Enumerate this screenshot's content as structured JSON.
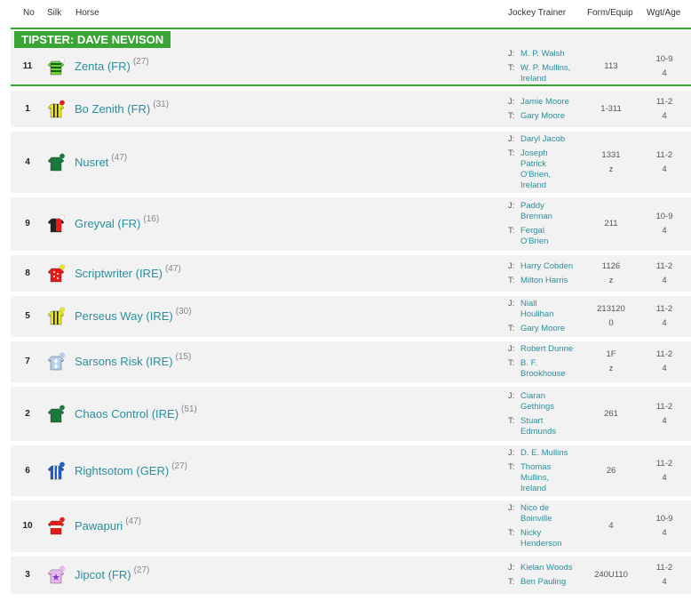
{
  "header": {
    "no": "No",
    "silk": "Silk",
    "horse": "Horse",
    "jockey_trainer": "Jockey Trainer",
    "form": "Form/Equip",
    "wgt": "Wgt/Age"
  },
  "tipster": {
    "label": "TIPSTER: DAVE NEVISON"
  },
  "prefix": {
    "j": "J:",
    "t": "T:"
  },
  "runners": [
    {
      "no": "11",
      "name": "Zenta (FR)",
      "days": "(27)",
      "jockey": [
        "M. P. Walsh"
      ],
      "trainer": [
        "W. P. Mullins,",
        "Ireland"
      ],
      "form": [
        "113"
      ],
      "wgt": "10-9",
      "age": "4",
      "silk": {
        "body": "#6fd63a",
        "stripe": "#1a5c1a",
        "pattern": "hoops",
        "cap": "#ffffff"
      }
    },
    {
      "no": "1",
      "name": "Bo Zenith (FR)",
      "days": "(31)",
      "jockey": [
        "Jamie Moore"
      ],
      "trainer": [
        "Gary Moore"
      ],
      "form": [
        "1-311"
      ],
      "wgt": "11-2",
      "age": "4",
      "silk": {
        "body": "#e8e81a",
        "stripe": "#222222",
        "pattern": "stripes",
        "cap": "#e81a1a"
      }
    },
    {
      "no": "4",
      "name": "Nusret",
      "days": "(47)",
      "jockey": [
        "Daryl Jacob"
      ],
      "trainer": [
        "Joseph",
        "Patrick",
        "O'Brien,",
        "Ireland"
      ],
      "form": [
        "1331",
        "z"
      ],
      "wgt": "11-2",
      "age": "4",
      "silk": {
        "body": "#1a7a3a",
        "stripe": "#1a7a3a",
        "pattern": "plain",
        "cap": "#1a7a3a"
      }
    },
    {
      "no": "9",
      "name": "Greyval (FR)",
      "days": "(16)",
      "jockey": [
        "Paddy",
        "Brennan"
      ],
      "trainer": [
        "Fergal",
        "O'Brien"
      ],
      "form": [
        "211"
      ],
      "wgt": "10-9",
      "age": "4",
      "silk": {
        "body": "#222222",
        "stripe": "#e81a1a",
        "pattern": "diagonal",
        "cap": "#ffffff"
      }
    },
    {
      "no": "8",
      "name": "Scriptwriter (IRE)",
      "days": "(47)",
      "jockey": [
        "Harry Cobden"
      ],
      "trainer": [
        "Milton Harris"
      ],
      "form": [
        "1126",
        "z"
      ],
      "wgt": "11-2",
      "age": "4",
      "silk": {
        "body": "#e81a1a",
        "stripe": "#ffffff",
        "pattern": "spots",
        "cap": "#e8e81a"
      }
    },
    {
      "no": "5",
      "name": "Perseus Way (IRE)",
      "days": "(30)",
      "jockey": [
        "Niall",
        "Houlihan"
      ],
      "trainer": [
        "Gary Moore"
      ],
      "form": [
        "213120",
        "0"
      ],
      "wgt": "11-2",
      "age": "4",
      "silk": {
        "body": "#e8e81a",
        "stripe": "#222222",
        "pattern": "stripes",
        "cap": "#e8e81a"
      }
    },
    {
      "no": "7",
      "name": "Sarsons Risk (IRE)",
      "days": "(15)",
      "jockey": [
        "Robert Dunne"
      ],
      "trainer": [
        "B. F.",
        "Brookhouse"
      ],
      "form": [
        "1F",
        "z"
      ],
      "wgt": "11-2",
      "age": "4",
      "silk": {
        "body": "#b8d0f0",
        "stripe": "#ffffff",
        "pattern": "diamonds",
        "cap": "#b8d0f0"
      }
    },
    {
      "no": "2",
      "name": "Chaos Control (IRE)",
      "days": "(51)",
      "jockey": [
        "Ciaran",
        "Gethings"
      ],
      "trainer": [
        "Stuart",
        "Edmunds"
      ],
      "form": [
        "261"
      ],
      "wgt": "11-2",
      "age": "4",
      "silk": {
        "body": "#1a7a3a",
        "stripe": "#1a7a3a",
        "pattern": "plain",
        "cap": "#1a7a3a"
      }
    },
    {
      "no": "6",
      "name": "Rightsotom (GER)",
      "days": "(27)",
      "jockey": [
        "D. E. Mullins"
      ],
      "trainer": [
        "Thomas",
        "Mullins,",
        "Ireland"
      ],
      "form": [
        "26"
      ],
      "wgt": "11-2",
      "age": "4",
      "silk": {
        "body": "#1a5cc8",
        "stripe": "#ffffff",
        "pattern": "stripes",
        "cap": "#1a5cc8"
      }
    },
    {
      "no": "10",
      "name": "Pawapuri",
      "days": "(47)",
      "jockey": [
        "Nico de",
        "Boinville"
      ],
      "trainer": [
        "Nicky",
        "Henderson"
      ],
      "form": [
        "4"
      ],
      "wgt": "10-9",
      "age": "4",
      "silk": {
        "body": "#e81a1a",
        "stripe": "#ffffff",
        "pattern": "band",
        "cap": "#e81a1a"
      }
    },
    {
      "no": "3",
      "name": "Jipcot (FR)",
      "days": "(27)",
      "jockey": [
        "Kielan Woods"
      ],
      "trainer": [
        "Ben Pauling"
      ],
      "form": [
        "240U110"
      ],
      "wgt": "11-2",
      "age": "4",
      "silk": {
        "body": "#e8b8f0",
        "stripe": "#7a3ab8",
        "pattern": "star",
        "cap": "#e8b8f0"
      }
    }
  ]
}
